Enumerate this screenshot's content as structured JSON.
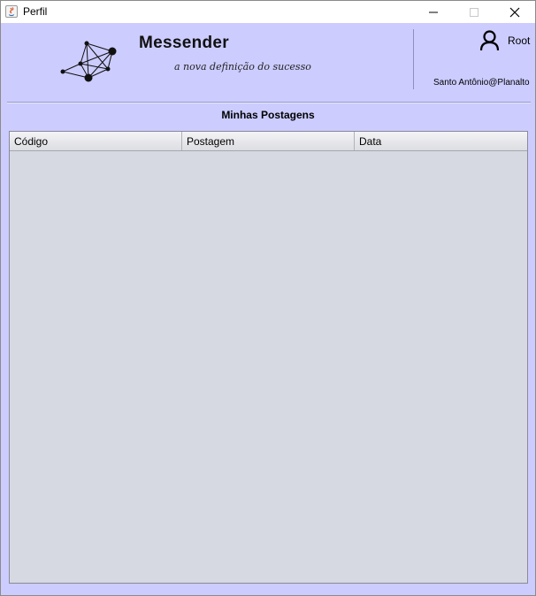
{
  "window": {
    "title": "Perfil"
  },
  "header": {
    "app_name": "Messender",
    "slogan": "a nova definição do sucesso",
    "user_name": "Root",
    "location": "Santo Antônio@Planalto"
  },
  "main": {
    "section_title": "Minhas Postagens",
    "table": {
      "columns": [
        "Código",
        "Postagem",
        "Data"
      ],
      "rows": []
    }
  },
  "colors": {
    "background": "#ccccff",
    "table_body": "#d6d9e1"
  }
}
